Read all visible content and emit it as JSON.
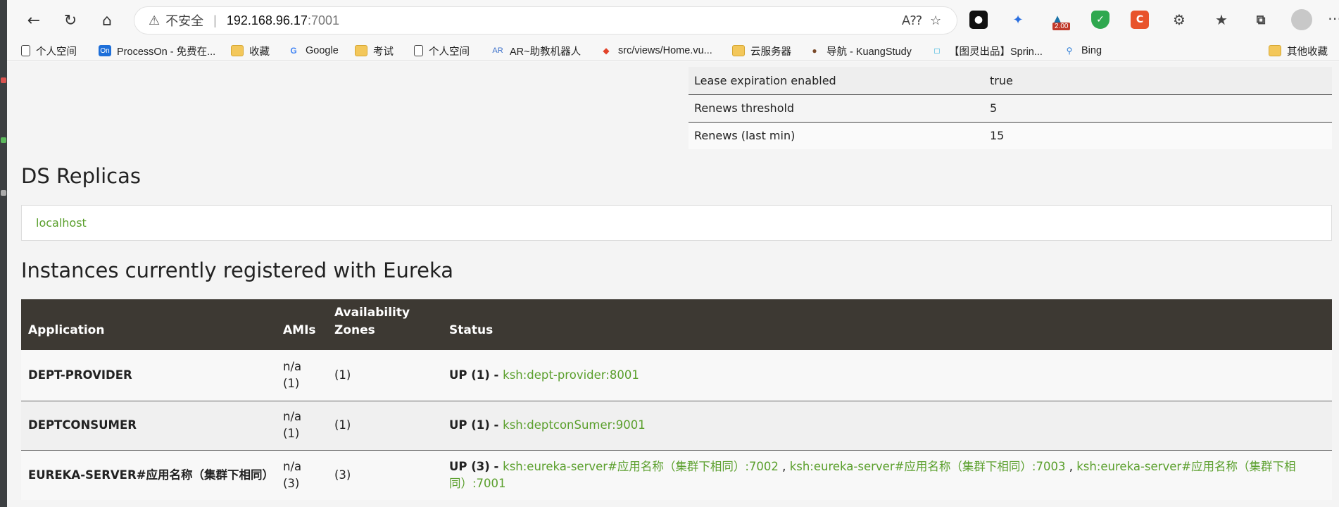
{
  "browser": {
    "security_label": "不安全",
    "url_host": "192.168.96.17",
    "url_port": ":7001",
    "badge": "2.00"
  },
  "bookmarks": [
    {
      "label": "个人空间",
      "icon": "doc-icon"
    },
    {
      "label": "ProcessOn - 免费在...",
      "icon": "processon-icon"
    },
    {
      "label": "收藏",
      "icon": "folder-icon"
    },
    {
      "label": "Google",
      "icon": "google-icon"
    },
    {
      "label": "考试",
      "icon": "folder-icon"
    },
    {
      "label": "个人空间",
      "icon": "doc-icon"
    },
    {
      "label": "AR~助教机器人",
      "icon": "ar-icon"
    },
    {
      "label": "src/views/Home.vu...",
      "icon": "gitlab-icon"
    },
    {
      "label": "云服务器",
      "icon": "folder-icon"
    },
    {
      "label": "导航 - KuangStudy",
      "icon": "avatar-icon"
    },
    {
      "label": "【图灵出品】Sprin...",
      "icon": "bilibili-icon"
    },
    {
      "label": "Bing",
      "icon": "search-icon"
    },
    {
      "label": "其他收藏",
      "icon": "folder-icon"
    }
  ],
  "lease_table": [
    {
      "key": "Lease expiration enabled",
      "value": "true"
    },
    {
      "key": "Renews threshold",
      "value": "5"
    },
    {
      "key": "Renews (last min)",
      "value": "15"
    }
  ],
  "replicas": {
    "title": "DS Replicas",
    "item": "localhost"
  },
  "instances": {
    "title": "Instances currently registered with Eureka",
    "headers": {
      "application": "Application",
      "amis": "AMIs",
      "zones_line1": "Availability",
      "zones_line2": "Zones",
      "status": "Status"
    },
    "rows": [
      {
        "app": "DEPT-PROVIDER",
        "ami": "n/a",
        "ami_count": "(1)",
        "zones": "(1)",
        "status_prefix": "UP (1) - ",
        "links": [
          "ksh:dept-provider:8001"
        ]
      },
      {
        "app": "DEPTCONSUMER",
        "ami": "n/a",
        "ami_count": "(1)",
        "zones": "(1)",
        "status_prefix": "UP (1) - ",
        "links": [
          "ksh:deptconSumer:9001"
        ]
      },
      {
        "app": "EUREKA-SERVER#应用名称（集群下相同）",
        "ami": "n/a",
        "ami_count": "(3)",
        "zones": "(3)",
        "status_prefix": "UP (3) - ",
        "links": [
          "ksh:eureka-server#应用名称（集群下相同）:7002",
          "ksh:eureka-server#应用名称（集群下相同）:7003",
          "ksh:eureka-server#应用名称（集群下相同）:7001"
        ],
        "link_sep": " , "
      }
    ]
  }
}
